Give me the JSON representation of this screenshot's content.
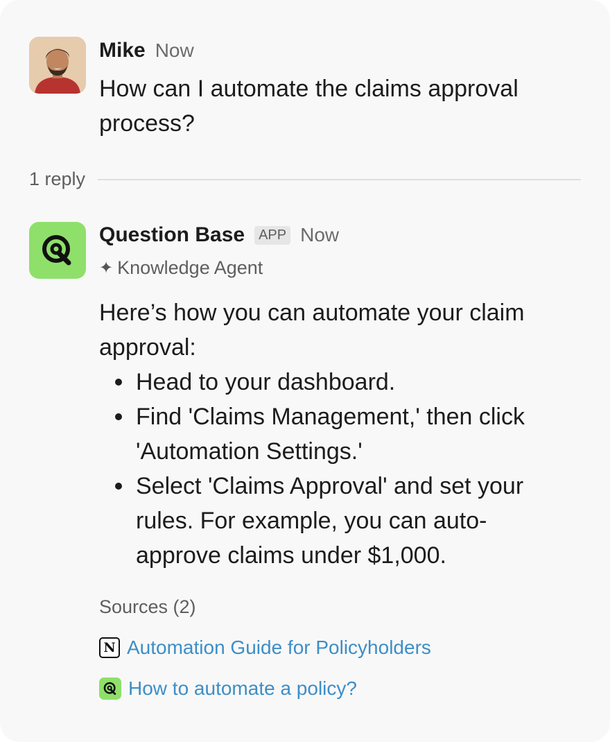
{
  "message_user": {
    "sender": "Mike",
    "time": "Now",
    "text_line1": "How can I automate the claims approval",
    "text_line2": "process?"
  },
  "thread": {
    "reply_count": "1 reply"
  },
  "message_bot": {
    "sender": "Question Base",
    "badge": "APP",
    "time": "Now",
    "subtitle": "Knowledge Agent",
    "intro_line1": "Here’s how you can automate your claim",
    "intro_line2": "approval:",
    "steps": [
      [
        "Head to your dashboard."
      ],
      [
        "Find 'Claims Management,' then click",
        "'Automation Settings.'"
      ],
      [
        "Select 'Claims Approval' and set your",
        "rules. For example, you can auto-",
        "approve claims under $1,000."
      ]
    ],
    "sources_title": "Sources (2)",
    "sources": [
      {
        "label": "Automation Guide for Policyholders",
        "icon": "notion-icon"
      },
      {
        "label": "How to automate a policy?",
        "icon": "question-base-icon"
      }
    ]
  },
  "colors": {
    "link": "#3d8ec7",
    "brand_green": "#8ee06a"
  }
}
